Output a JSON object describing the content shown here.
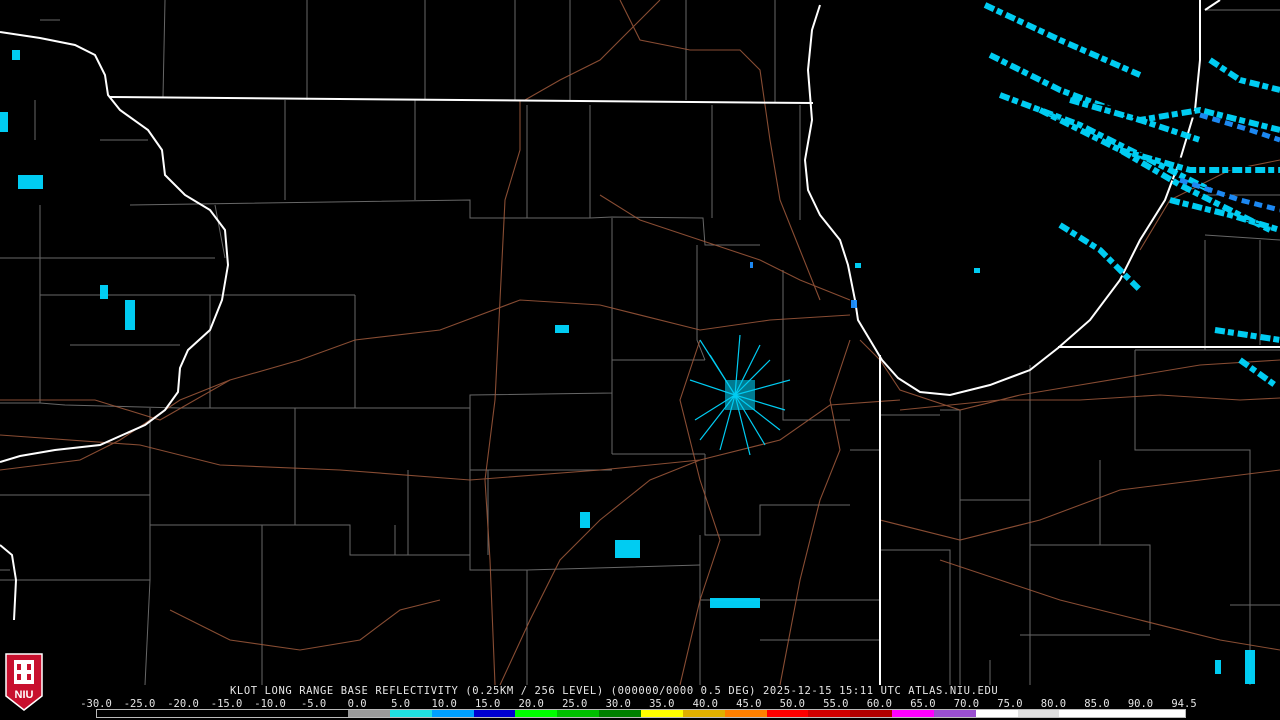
{
  "caption": "KLOT LONG RANGE BASE REFLECTIVITY (0.25KM / 256 LEVEL) (000000/0000 0.5 DEG) 2025-12-15 15:11 UTC  ATLAS.NIU.EDU",
  "scale_labels": [
    "-30.0",
    "-25.0",
    "-20.0",
    "-15.0",
    "-10.0",
    "-5.0",
    "0.0",
    "5.0",
    "10.0",
    "15.0",
    "20.0",
    "25.0",
    "30.0",
    "35.0",
    "40.0",
    "45.0",
    "50.0",
    "55.0",
    "60.0",
    "65.0",
    "70.0",
    "75.0",
    "80.0",
    "85.0",
    "90.0",
    "94.5"
  ],
  "scale_colors": [
    "#ffffff",
    "#ffffff",
    "#ffffff",
    "#ffffff",
    "#ffffff",
    "#ffffff",
    "#9a9a9a",
    "#20e0e0",
    "#00a0ff",
    "#0000d0",
    "#00ff00",
    "#00c000",
    "#008000",
    "#ffff00",
    "#e0b000",
    "#ff8000",
    "#ff0000",
    "#d00000",
    "#b00000",
    "#ff00ff",
    "#9a50d0",
    "#ffffff",
    "#e0e0e0",
    "#ffffff",
    "#ffffff",
    "#ffffff"
  ],
  "logo_text": "NIU",
  "colors": {
    "background": "#000000",
    "state_border": "#ffffff",
    "county_border": "#8a8a8a",
    "highway": "#a05a3c",
    "echo_light": "#00d7ff",
    "echo_medium": "#1e90ff"
  }
}
